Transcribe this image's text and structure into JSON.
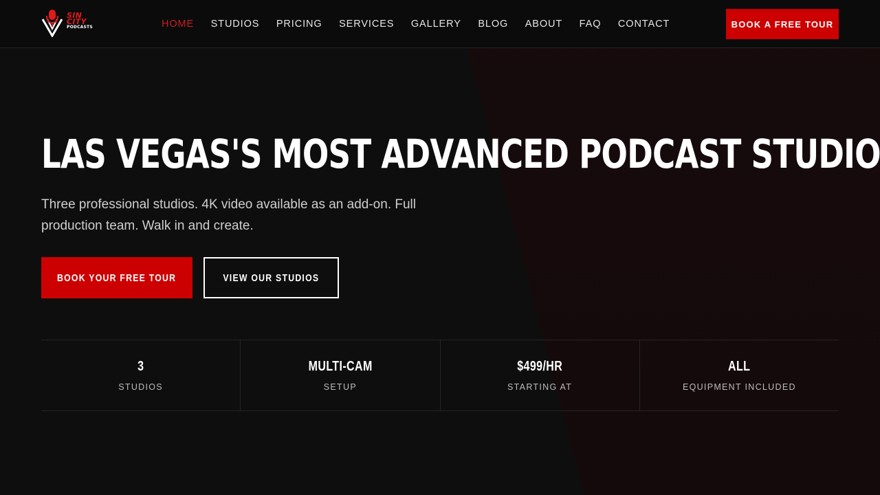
{
  "brand": {
    "logo_line1": "SIN",
    "logo_line2": "CITY",
    "logo_line3": "PODCASTS",
    "accent_color": "#cc0000"
  },
  "nav": {
    "items": [
      {
        "label": "HOME",
        "active": true
      },
      {
        "label": "STUDIOS"
      },
      {
        "label": "PRICING"
      },
      {
        "label": "SERVICES"
      },
      {
        "label": "GALLERY"
      },
      {
        "label": "BLOG"
      },
      {
        "label": "ABOUT"
      },
      {
        "label": "FAQ"
      },
      {
        "label": "CONTACT"
      }
    ],
    "cta_label": "BOOK A FREE TOUR"
  },
  "hero": {
    "title": "LAS VEGAS'S MOST ADVANCED PODCAST STUDIO",
    "subtitle": "Three professional studios. 4K video available as an add-on. Full production team. Walk in and create.",
    "primary_button": "BOOK YOUR FREE TOUR",
    "secondary_button": "VIEW OUR STUDIOS"
  },
  "stats": [
    {
      "value": "3",
      "label": "STUDIOS"
    },
    {
      "value": "MULTI-CAM",
      "label": "SETUP"
    },
    {
      "value": "$499/HR",
      "label": "STARTING AT"
    },
    {
      "value": "ALL",
      "label": "EQUIPMENT INCLUDED"
    }
  ]
}
